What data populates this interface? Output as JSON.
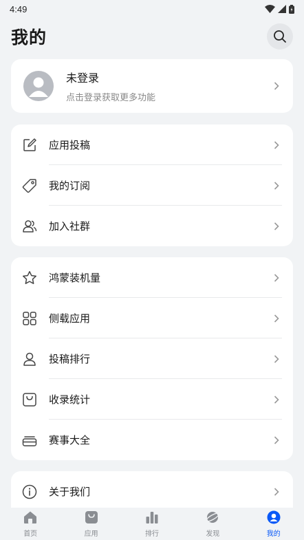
{
  "status": {
    "time": "4:49"
  },
  "header": {
    "title": "我的"
  },
  "profile": {
    "name": "未登录",
    "subtitle": "点击登录获取更多功能"
  },
  "group1": [
    {
      "label": "应用投稿",
      "icon": "edit-icon"
    },
    {
      "label": "我的订阅",
      "icon": "tag-icon"
    },
    {
      "label": "加入社群",
      "icon": "group-icon"
    }
  ],
  "group2": [
    {
      "label": "鸿蒙装机量",
      "icon": "star-icon"
    },
    {
      "label": "侧载应用",
      "icon": "grid-icon"
    },
    {
      "label": "投稿排行",
      "icon": "person-icon"
    },
    {
      "label": "收录统计",
      "icon": "bag-icon"
    },
    {
      "label": "赛事大全",
      "icon": "stack-icon"
    }
  ],
  "group3": [
    {
      "label": "关于我们",
      "icon": "info-icon"
    }
  ],
  "tabs": [
    {
      "label": "首页",
      "icon": "home-icon",
      "active": false
    },
    {
      "label": "应用",
      "icon": "app-bag-icon",
      "active": false
    },
    {
      "label": "排行",
      "icon": "bar-chart-icon",
      "active": false
    },
    {
      "label": "发现",
      "icon": "planet-icon",
      "active": false
    },
    {
      "label": "我的",
      "icon": "user-icon",
      "active": true
    }
  ],
  "colors": {
    "accent": "#0a59f7",
    "background": "#f1f3f5",
    "card": "#ffffff"
  }
}
